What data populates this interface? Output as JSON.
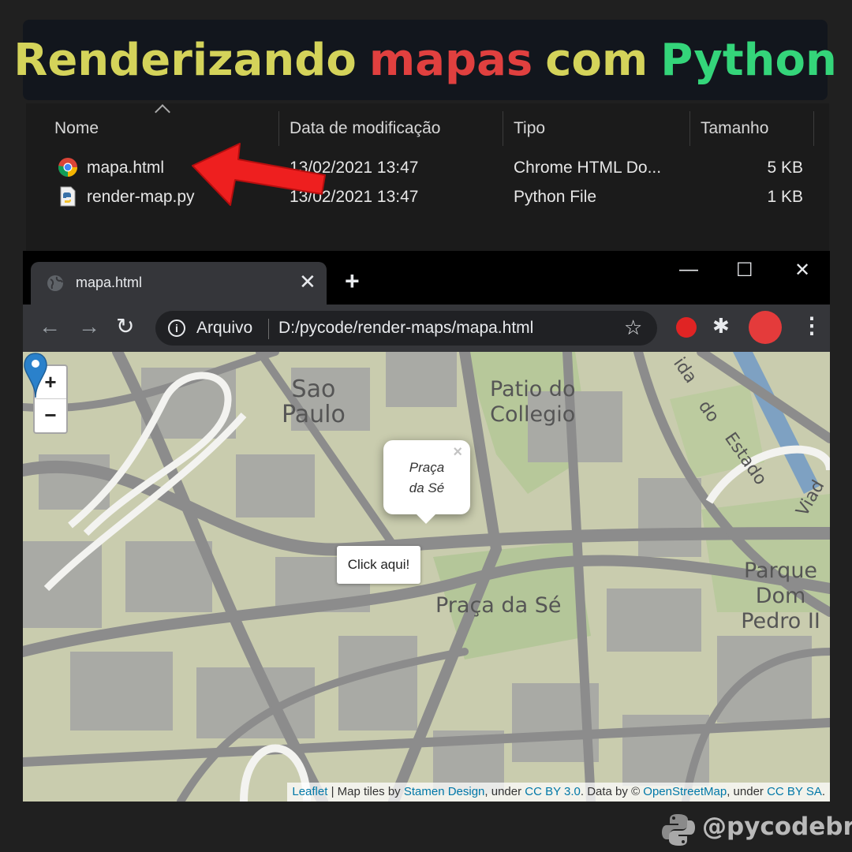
{
  "banner": {
    "word1": "Renderizando",
    "word2": "mapas",
    "word3": "com",
    "word4": "Python",
    "colors": {
      "word1": "#d4d35a",
      "word2": "#e0403f",
      "word3": "#d4d35a",
      "word4": "#34d57a"
    }
  },
  "explorer": {
    "columns": {
      "name": "Nome",
      "modified": "Data de modificação",
      "type": "Tipo",
      "size": "Tamanho"
    },
    "files": [
      {
        "icon": "chrome-icon",
        "name": "mapa.html",
        "modified": "13/02/2021 13:47",
        "type": "Chrome HTML Do...",
        "size": "5 KB"
      },
      {
        "icon": "python-file-icon",
        "name": "render-map.py",
        "modified": "13/02/2021 13:47",
        "type": "Python File",
        "size": "1 KB"
      }
    ]
  },
  "browser": {
    "tab_title": "mapa.html",
    "tab_close": "✕",
    "new_tab": "+",
    "window": {
      "minimize": "—",
      "maximize": "☐",
      "close": "✕"
    },
    "address": {
      "scheme_label": "Arquivo",
      "url": "D:/pycode/render-maps/mapa.html"
    }
  },
  "map": {
    "zoom_in": "+",
    "zoom_out": "−",
    "labels": {
      "sao_paulo_1": "Sao",
      "sao_paulo_2": "Paulo",
      "patio_1": "Patio do",
      "patio_2": "Collegio",
      "praca": "Praça da Sé",
      "parque_1": "Parque Dom",
      "parque_2": "Pedro II",
      "road_1": "ida",
      "road_2": "do",
      "road_3": "Estado",
      "road_4": "Viad"
    },
    "popup": {
      "line1": "Praça",
      "line2": "da Sé",
      "close": "×"
    },
    "tooltip": "Click aqui!",
    "attribution": {
      "leaflet": "Leaflet",
      "t1": " | Map tiles by ",
      "stamen": "Stamen Design",
      "t2": ", under ",
      "cc30": "CC BY 3.0",
      "t3": ". Data by © ",
      "osm": "OpenStreetMap",
      "t4": ", under ",
      "ccbysa": "CC BY SA",
      "t5": "."
    }
  },
  "brand": {
    "handle": "@pycodebr"
  }
}
